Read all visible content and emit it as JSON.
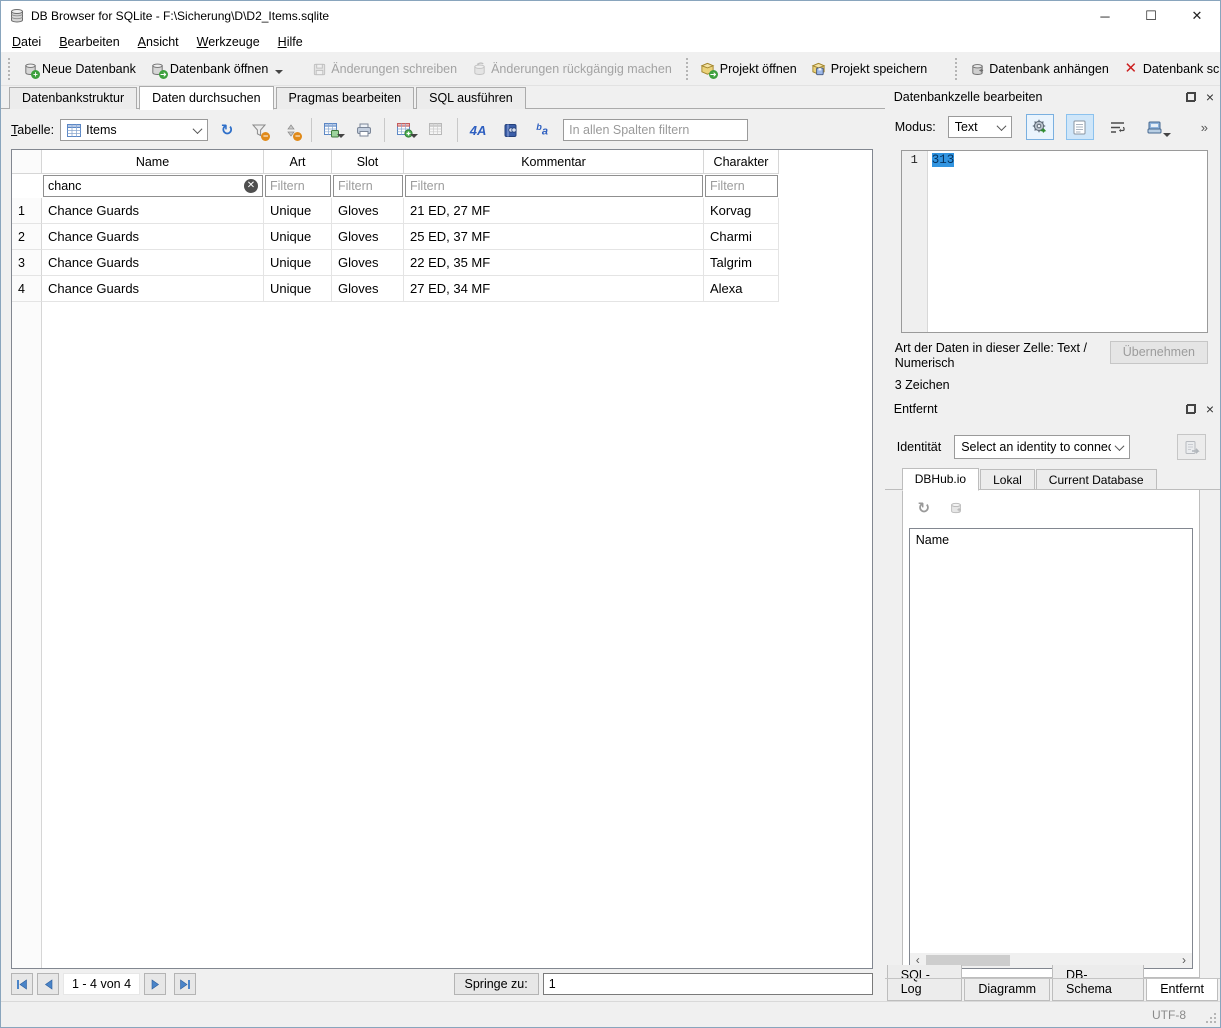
{
  "colors": {
    "selection_blue": "#3194e0",
    "toolbar_bg": "#f0f0f0",
    "close_red": "#cc1f1f",
    "badge_green": "#3ea03e",
    "badge_orange": "#e08a1a",
    "icon_blue": "#2e6fc9"
  },
  "window": {
    "title": "DB Browser for SQLite - F:\\Sicherung\\D\\D2_Items.sqlite"
  },
  "menu": {
    "items": [
      "Datei",
      "Bearbeiten",
      "Ansicht",
      "Werkzeuge",
      "Hilfe"
    ]
  },
  "toolbar": {
    "new_db": "Neue Datenbank",
    "open_db": "Datenbank öffnen",
    "write_changes": "Änderungen schreiben",
    "revert_changes": "Änderungen rückgängig machen",
    "open_project": "Projekt öffnen",
    "save_project": "Projekt speichern",
    "attach_db": "Datenbank anhängen",
    "close_db": "Datenbank schließen"
  },
  "main_tabs": {
    "structure": "Datenbankstruktur",
    "browse": "Daten durchsuchen",
    "pragmas": "Pragmas bearbeiten",
    "sql": "SQL ausführen"
  },
  "browse": {
    "table_label": "Tabelle:",
    "table_value": "Items",
    "filter_all_placeholder": "In allen Spalten filtern",
    "grid": {
      "columns": {
        "name": "Name",
        "art": "Art",
        "slot": "Slot",
        "kommentar": "Kommentar",
        "charakter": "Charakter"
      },
      "filter_value_name": "chanc",
      "filter_placeholder": "Filtern",
      "rows": [
        {
          "num": "1",
          "name": "Chance Guards",
          "art": "Unique",
          "slot": "Gloves",
          "kommentar": "21 ED, 27 MF",
          "charakter": "Korvag"
        },
        {
          "num": "2",
          "name": "Chance Guards",
          "art": "Unique",
          "slot": "Gloves",
          "kommentar": "25 ED, 37 MF",
          "charakter": "Charmi"
        },
        {
          "num": "3",
          "name": "Chance Guards",
          "art": "Unique",
          "slot": "Gloves",
          "kommentar": "22 ED, 35 MF",
          "charakter": "Talgrim"
        },
        {
          "num": "4",
          "name": "Chance Guards",
          "art": "Unique",
          "slot": "Gloves",
          "kommentar": "27 ED, 34 MF",
          "charakter": "Alexa"
        }
      ]
    },
    "nav": {
      "counter": "1 - 4 von 4",
      "goto_label": "Springe zu:",
      "goto_value": "1"
    }
  },
  "cell_panel": {
    "title": "Datenbankzelle bearbeiten",
    "mode_label": "Modus:",
    "mode_value": "Text",
    "overflow": "»",
    "line_number": "1",
    "cell_value": "313",
    "type_info": "Art der Daten in dieser Zelle: Text / Numerisch",
    "apply_label": "Übernehmen",
    "size_info": "3 Zeichen"
  },
  "remote_panel": {
    "title": "Entfernt",
    "identity_label": "Identität",
    "identity_value": "Select an identity to connec",
    "tabs": {
      "dbhub": "DBHub.io",
      "local": "Lokal",
      "current": "Current Database"
    },
    "list_header": "Name"
  },
  "dock_tabs": {
    "sql_log": "SQL-Log",
    "diagram": "Diagramm",
    "db_schema": "DB-Schema",
    "remote": "Entfernt"
  },
  "statusbar": {
    "encoding": "UTF-8"
  }
}
